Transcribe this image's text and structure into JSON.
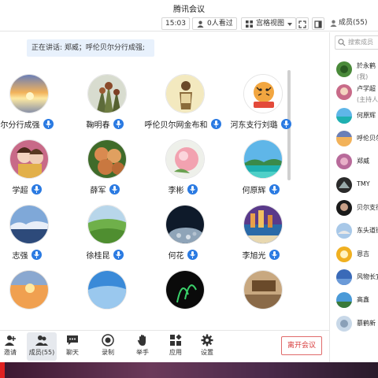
{
  "window": {
    "title": "腾讯会议"
  },
  "toolbar": {
    "time": "15:03",
    "viewers": "0人看过",
    "view_mode": "宫格视图",
    "members_label": "成员(55)"
  },
  "stage": {
    "speaking": "正在讲话: 郑威；呼伦贝尔分行成强;",
    "tiles": [
      {
        "name": "尔分行成强",
        "avatar": "sunset-clouds"
      },
      {
        "name": "鞠明春",
        "avatar": "sorghum"
      },
      {
        "name": "呼伦贝尔网金布和",
        "avatar": "figure-yellow"
      },
      {
        "name": "河东支行刘璐",
        "avatar": "tiger-cartoon"
      },
      {
        "name": "学超",
        "avatar": "dolls"
      },
      {
        "name": "薛军",
        "avatar": "fruit"
      },
      {
        "name": "李彬",
        "avatar": "peach"
      },
      {
        "name": "何原辉",
        "avatar": "tropical-sea"
      },
      {
        "name": "志强",
        "avatar": "sea-clouds"
      },
      {
        "name": "徐桂昆",
        "avatar": "green-field"
      },
      {
        "name": "何花",
        "avatar": "night-stones"
      },
      {
        "name": "李旭光",
        "avatar": "city-beach"
      },
      {
        "name": "",
        "avatar": "sunset-orange"
      },
      {
        "name": "",
        "avatar": "blue-sky"
      },
      {
        "name": "",
        "avatar": "dark-plant"
      },
      {
        "name": "",
        "avatar": "room"
      }
    ]
  },
  "bottom": {
    "buttons": [
      {
        "label": "邀请",
        "icon": "invite-icon"
      },
      {
        "label": "成员(55)",
        "icon": "members-icon"
      },
      {
        "label": "聊天",
        "icon": "chat-icon"
      },
      {
        "label": "录制",
        "icon": "record-icon"
      },
      {
        "label": "举手",
        "icon": "raise-hand-icon"
      },
      {
        "label": "应用",
        "icon": "apps-icon"
      },
      {
        "label": "设置",
        "icon": "settings-icon"
      }
    ],
    "leave": "离开会议"
  },
  "panel": {
    "search_placeholder": "搜索成员",
    "members": [
      {
        "name": "於永鹤",
        "sub": "(我)"
      },
      {
        "name": "卢学超",
        "sub": "(主持人"
      },
      {
        "name": "何原辉"
      },
      {
        "name": "呼伦贝尔"
      },
      {
        "name": "郑威"
      },
      {
        "name": "TMY"
      },
      {
        "name": "贝尔支行"
      },
      {
        "name": "东头道街"
      },
      {
        "name": "恩吉"
      },
      {
        "name": "风物长宜"
      },
      {
        "name": "高鑫"
      },
      {
        "name": "慕鹤新"
      }
    ]
  }
}
